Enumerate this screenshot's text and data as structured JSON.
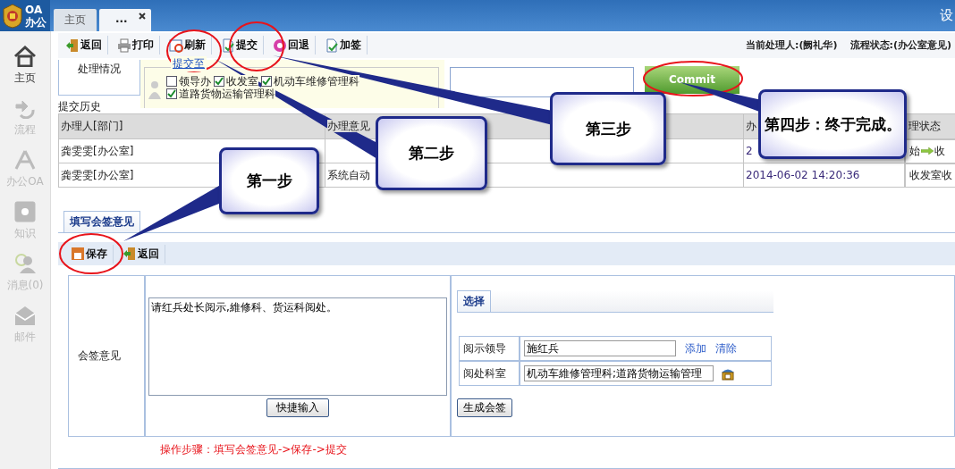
{
  "header": {
    "logo_text": "OA",
    "logo_subtext": "办公",
    "right_text": "设",
    "tabs": [
      {
        "label": "主页",
        "selected": false,
        "closable": false
      },
      {
        "label": "...",
        "selected": true,
        "closable": true
      }
    ]
  },
  "sidebar": {
    "items": [
      {
        "label": "主页",
        "kind": "home",
        "selected": true
      },
      {
        "label": "流程",
        "kind": "flow",
        "selected": false
      },
      {
        "label": "办公OA",
        "kind": "office",
        "selected": false
      },
      {
        "label": "知识",
        "kind": "knowledge",
        "selected": false
      },
      {
        "label": "消息(0)",
        "kind": "message",
        "selected": false
      },
      {
        "label": "邮件",
        "kind": "mail",
        "selected": false
      }
    ]
  },
  "toolbar": {
    "buttons": [
      {
        "label": "返回",
        "kind": "back"
      },
      {
        "label": "打印",
        "kind": "print"
      },
      {
        "label": "刷新",
        "kind": "refresh"
      },
      {
        "label": "提交",
        "kind": "submit"
      },
      {
        "label": "回退",
        "kind": "rollback"
      },
      {
        "label": "加签",
        "kind": "addsign"
      }
    ],
    "current_handler": "当前处理人:(阙礼华)",
    "flow_status": "流程状态:(办公室意见)"
  },
  "submit_panel": {
    "side_label": "处理情况",
    "legend": "提交至",
    "commit_button": "Commit",
    "options": [
      {
        "label": "领导办",
        "checked": false
      },
      {
        "label": "收发室",
        "checked": true
      },
      {
        "label": "机动车维修管理科",
        "checked": true
      },
      {
        "label": "道路货物运输管理科",
        "checked": true
      }
    ]
  },
  "history": {
    "title": "提交历史",
    "columns": [
      "办理人[部门]",
      "办理意见",
      "办",
      "理状态"
    ],
    "rows": [
      {
        "handler": "龚雯雯[办公室]",
        "time": "2",
        "status_from": "始",
        "status_to": "收"
      },
      {
        "handler": "龚雯雯[办公室]",
        "opinion": "系统自动",
        "time": "2014-06-02 14:20:36",
        "status": "收发室收"
      }
    ]
  },
  "sign_form": {
    "tab": {
      "label": "填写会签意见",
      "selected": true
    },
    "buttons": [
      {
        "label": "保存",
        "kind": "save"
      },
      {
        "label": "返回",
        "kind": "back"
      }
    ],
    "opinion_label": "会签意见",
    "opinion_text": "请红兵处长阅示,維修科、货运科阅处。",
    "quick_input_button": "快捷输入",
    "select_tab": {
      "label": "选择",
      "selected": true
    },
    "leader_label": "阅示领导",
    "leader_value": "施红兵",
    "add_link": "添加",
    "clear_link": "清除",
    "dept_label": "阅处科室",
    "dept_value": "机动车維修管理科;道路货物运输管理",
    "generate_button": "生成会签",
    "steps_note": "操作步骤：填写会签意见->保存->提交"
  },
  "callouts": [
    {
      "text": "第一步"
    },
    {
      "text": "第二步"
    },
    {
      "text": "第三步"
    },
    {
      "text": "第四步：终于完成。"
    }
  ]
}
